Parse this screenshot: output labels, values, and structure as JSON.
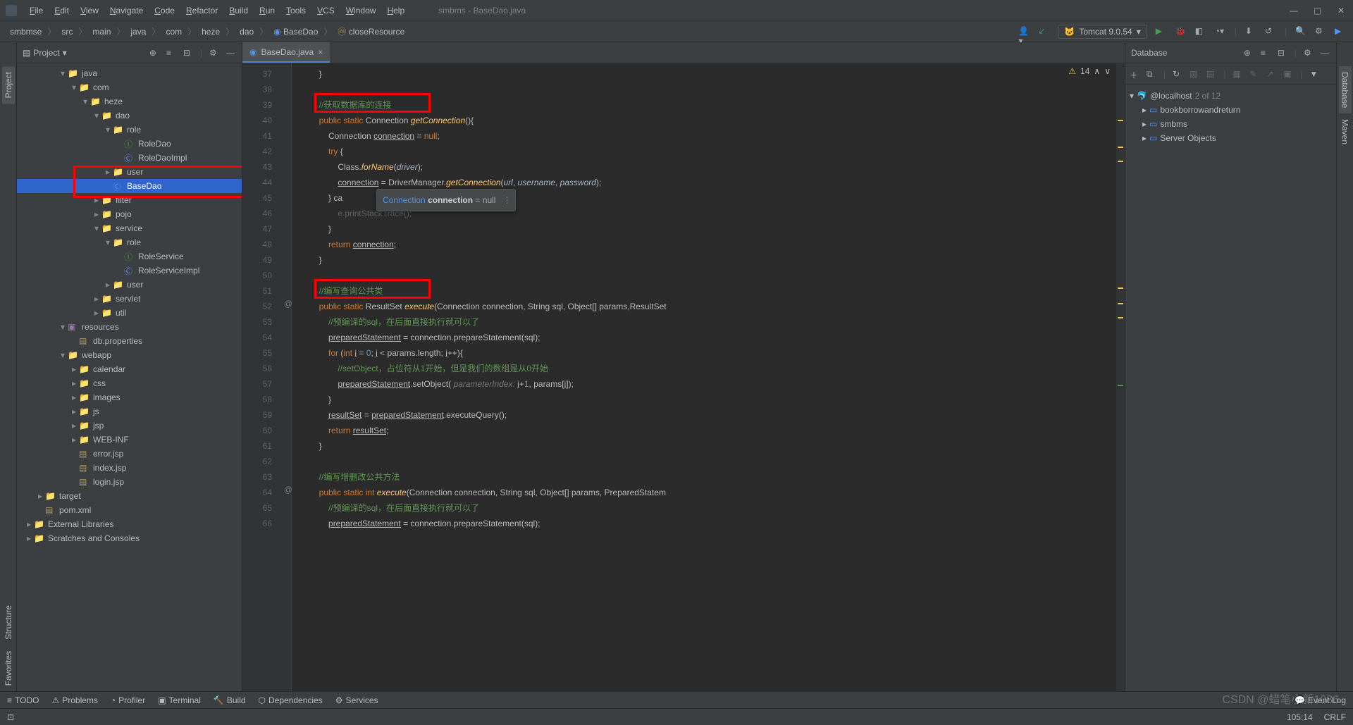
{
  "window": {
    "title": "smbms - BaseDao.java"
  },
  "menu": [
    "File",
    "Edit",
    "View",
    "Navigate",
    "Code",
    "Refactor",
    "Build",
    "Run",
    "Tools",
    "VCS",
    "Window",
    "Help"
  ],
  "breadcrumb": [
    "smbmse",
    "src",
    "main",
    "java",
    "com",
    "heze",
    "dao",
    "BaseDao",
    "closeResource"
  ],
  "run_config": "Tomcat 9.0.54",
  "project_panel": {
    "title": "Project"
  },
  "tree": [
    {
      "depth": 3,
      "toggle": "▾",
      "icon": "folder",
      "label": "java"
    },
    {
      "depth": 4,
      "toggle": "▾",
      "icon": "folder",
      "label": "com"
    },
    {
      "depth": 5,
      "toggle": "▾",
      "icon": "folder",
      "label": "heze"
    },
    {
      "depth": 6,
      "toggle": "▾",
      "icon": "folder",
      "label": "dao"
    },
    {
      "depth": 7,
      "toggle": "▾",
      "icon": "folder",
      "label": "role"
    },
    {
      "depth": 8,
      "toggle": "",
      "icon": "interface",
      "label": "RoleDao"
    },
    {
      "depth": 8,
      "toggle": "",
      "icon": "class",
      "label": "RoleDaoImpl"
    },
    {
      "depth": 7,
      "toggle": "▸",
      "icon": "folder",
      "label": "user"
    },
    {
      "depth": 7,
      "toggle": "",
      "icon": "class",
      "label": "BaseDao",
      "selected": true
    },
    {
      "depth": 6,
      "toggle": "▸",
      "icon": "folder",
      "label": "filter"
    },
    {
      "depth": 6,
      "toggle": "▸",
      "icon": "folder",
      "label": "pojo"
    },
    {
      "depth": 6,
      "toggle": "▾",
      "icon": "folder",
      "label": "service"
    },
    {
      "depth": 7,
      "toggle": "▾",
      "icon": "folder",
      "label": "role"
    },
    {
      "depth": 8,
      "toggle": "",
      "icon": "interface",
      "label": "RoleService"
    },
    {
      "depth": 8,
      "toggle": "",
      "icon": "class",
      "label": "RoleServiceImpl"
    },
    {
      "depth": 7,
      "toggle": "▸",
      "icon": "folder",
      "label": "user"
    },
    {
      "depth": 6,
      "toggle": "▸",
      "icon": "folder",
      "label": "servlet"
    },
    {
      "depth": 6,
      "toggle": "▸",
      "icon": "folder",
      "label": "util"
    },
    {
      "depth": 3,
      "toggle": "▾",
      "icon": "resources",
      "label": "resources"
    },
    {
      "depth": 4,
      "toggle": "",
      "icon": "file",
      "label": "db.properties"
    },
    {
      "depth": 3,
      "toggle": "▾",
      "icon": "folder",
      "label": "webapp"
    },
    {
      "depth": 4,
      "toggle": "▸",
      "icon": "folder",
      "label": "calendar"
    },
    {
      "depth": 4,
      "toggle": "▸",
      "icon": "folder",
      "label": "css"
    },
    {
      "depth": 4,
      "toggle": "▸",
      "icon": "folder",
      "label": "images"
    },
    {
      "depth": 4,
      "toggle": "▸",
      "icon": "folder",
      "label": "js"
    },
    {
      "depth": 4,
      "toggle": "▸",
      "icon": "folder",
      "label": "jsp"
    },
    {
      "depth": 4,
      "toggle": "▸",
      "icon": "folder",
      "label": "WEB-INF"
    },
    {
      "depth": 4,
      "toggle": "",
      "icon": "file",
      "label": "error.jsp"
    },
    {
      "depth": 4,
      "toggle": "",
      "icon": "file",
      "label": "index.jsp"
    },
    {
      "depth": 4,
      "toggle": "",
      "icon": "file",
      "label": "login.jsp"
    },
    {
      "depth": 1,
      "toggle": "▸",
      "icon": "target",
      "label": "target"
    },
    {
      "depth": 1,
      "toggle": "",
      "icon": "file",
      "label": "pom.xml"
    },
    {
      "depth": 0,
      "toggle": "▸",
      "icon": "folder",
      "label": "External Libraries"
    },
    {
      "depth": 0,
      "toggle": "▸",
      "icon": "folder",
      "label": "Scratches and Consoles"
    }
  ],
  "tab": {
    "name": "BaseDao.java"
  },
  "editor_status": {
    "warnings": "14",
    "label": "⚠"
  },
  "code_lines": [
    {
      "n": 37,
      "html": "        }"
    },
    {
      "n": 38,
      "html": ""
    },
    {
      "n": 39,
      "html": "        <span class='com-cn'>//获取数据库的连接</span>",
      "boxed": true
    },
    {
      "n": 40,
      "html": "        <span class='kw'>public static</span> Connection <span class='method'>getConnection</span>(){"
    },
    {
      "n": 41,
      "html": "            Connection <span class='ul'>connection</span> = <span class='kw'>null</span>;"
    },
    {
      "n": 42,
      "html": "            <span class='kw'>try</span> {"
    },
    {
      "n": 43,
      "html": "                Class.<span class='method'>forName</span>(<span class='field param'>driver</span>);"
    },
    {
      "n": 44,
      "html": "                <span class='ul'>connection</span> = DriverManager.<span class='method'>getConnection</span>(<span class='field param'>url</span>, <span class='field param'>username</span>, <span class='field param'>password</span>);"
    },
    {
      "n": 45,
      "html": "            } ca"
    },
    {
      "n": 46,
      "html": "                <span style='color:#606366'>e.printStackTrace();</span>"
    },
    {
      "n": 47,
      "html": "            }"
    },
    {
      "n": 48,
      "html": "            <span class='kw'>return</span> <span class='ul'>connection</span>;"
    },
    {
      "n": 49,
      "html": "        }"
    },
    {
      "n": 50,
      "html": ""
    },
    {
      "n": 51,
      "html": "        <span class='com-cn'>//编写查询公共类</span>",
      "boxed": true
    },
    {
      "n": 52,
      "html": "        <span class='kw'>public static</span> ResultSet <span class='method'>execute</span>(Connection connection, String sql, Object[] params,ResultSet",
      "ann": "@"
    },
    {
      "n": 53,
      "html": "            <span class='com-cn'>//预编译的sql，在后面直接执行就可以了</span>"
    },
    {
      "n": 54,
      "html": "            <span class='ul'>preparedStatement</span> = connection.prepareStatement(sql);"
    },
    {
      "n": 55,
      "html": "            <span class='kw'>for</span> (<span class='kw'>int</span> <span class='ul'>i</span> = <span style='color:#6897bb'>0</span>; <span class='ul'>i</span> &lt; params.length; <span class='ul'>i</span>++){"
    },
    {
      "n": 56,
      "html": "                <span class='com-cn'>//setObject，占位符从1开始，但是我们的数组是从0开始</span>"
    },
    {
      "n": 57,
      "html": "                <span class='ul'>preparedStatement</span>.setObject( <span class='hint'>parameterIndex:</span> <span class='ul'>i</span>+<span style='color:#6897bb'>1</span>, params[<span class='ul'>i</span>]);"
    },
    {
      "n": 58,
      "html": "            }"
    },
    {
      "n": 59,
      "html": "            <span class='ul'>resultSet</span> = <span class='ul'>preparedStatement</span>.executeQuery();"
    },
    {
      "n": 60,
      "html": "            <span class='kw'>return</span> <span class='ul'>resultSet</span>;"
    },
    {
      "n": 61,
      "html": "        }"
    },
    {
      "n": 62,
      "html": ""
    },
    {
      "n": 63,
      "html": "        <span class='com-cn'>//编写增删改公共方法</span>"
    },
    {
      "n": 64,
      "html": "        <span class='kw'>public static int</span> <span class='method'>execute</span>(Connection connection, String sql, Object[] params, PreparedStatem",
      "ann": "@"
    },
    {
      "n": 65,
      "html": "            <span class='com-cn'>//预编译的sql，在后面直接执行就可以了</span>"
    },
    {
      "n": 66,
      "html": "            <span class='ul'>preparedStatement</span> = connection.prepareStatement(sql);"
    }
  ],
  "popup": {
    "text_type": "Connection",
    "text_name": "connection",
    "text_eq": "= null"
  },
  "db": {
    "title": "Database",
    "host": "@localhost",
    "host_count": "2 of 12",
    "items": [
      "bookborrowandreturn",
      "smbms",
      "Server Objects"
    ]
  },
  "bottom_tabs": [
    "TODO",
    "Problems",
    "Profiler",
    "Terminal",
    "Build",
    "Dependencies",
    "Services"
  ],
  "status": {
    "event_log": "Event Log",
    "caret": "105:14",
    "encoding": "CRLF"
  },
  "left_tools": [
    "Project",
    "Structure",
    "Favorites"
  ],
  "right_tools": [
    "Database",
    "Maven"
  ],
  "watermark": "CSDN @蜡笔小新1086"
}
